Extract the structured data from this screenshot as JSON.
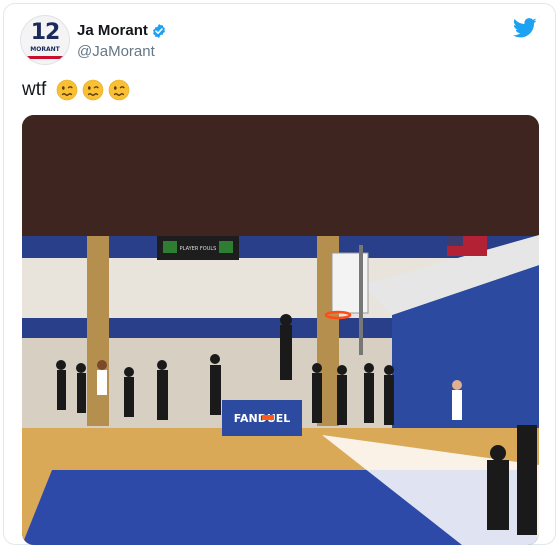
{
  "author": {
    "display_name": "Ja Morant",
    "handle": "@JaMorant",
    "avatar": {
      "jersey_number": "12",
      "jersey_name": "MORANT"
    },
    "verified_icon": "verified-badge-icon"
  },
  "tweet": {
    "text": "wtf",
    "emojis": [
      "woozy-face-icon",
      "woozy-face-icon",
      "woozy-face-icon"
    ]
  },
  "media": {
    "type": "video",
    "banner_text": "FANDUEL",
    "scoreboard_text": "PLAYER FOULS"
  },
  "brand": {
    "icon": "twitter-bird-icon",
    "color": "#1da1f2"
  },
  "colors": {
    "verified": "#1da1f2",
    "emoji": "#f9c036",
    "media_bg": "#3e2520"
  }
}
